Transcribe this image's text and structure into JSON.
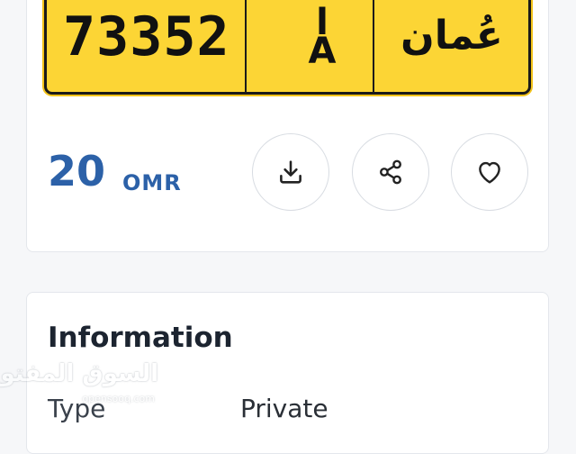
{
  "plate": {
    "number": "73352",
    "letter_arabic": "ا",
    "letter_latin": "A",
    "country_arabic": "عُمان",
    "background_color": "#fcd535"
  },
  "price": {
    "value": "20",
    "currency": "OMR",
    "color": "#2c61a8"
  },
  "actions": [
    {
      "icon": "download-icon"
    },
    {
      "icon": "share-icon"
    },
    {
      "icon": "heart-icon"
    }
  ],
  "information": {
    "title": "Information",
    "rows": [
      {
        "label": "Type",
        "value": "Private"
      }
    ]
  },
  "watermark": {
    "arabic": "السوق المفتوح",
    "latin": "opensooq.com"
  }
}
